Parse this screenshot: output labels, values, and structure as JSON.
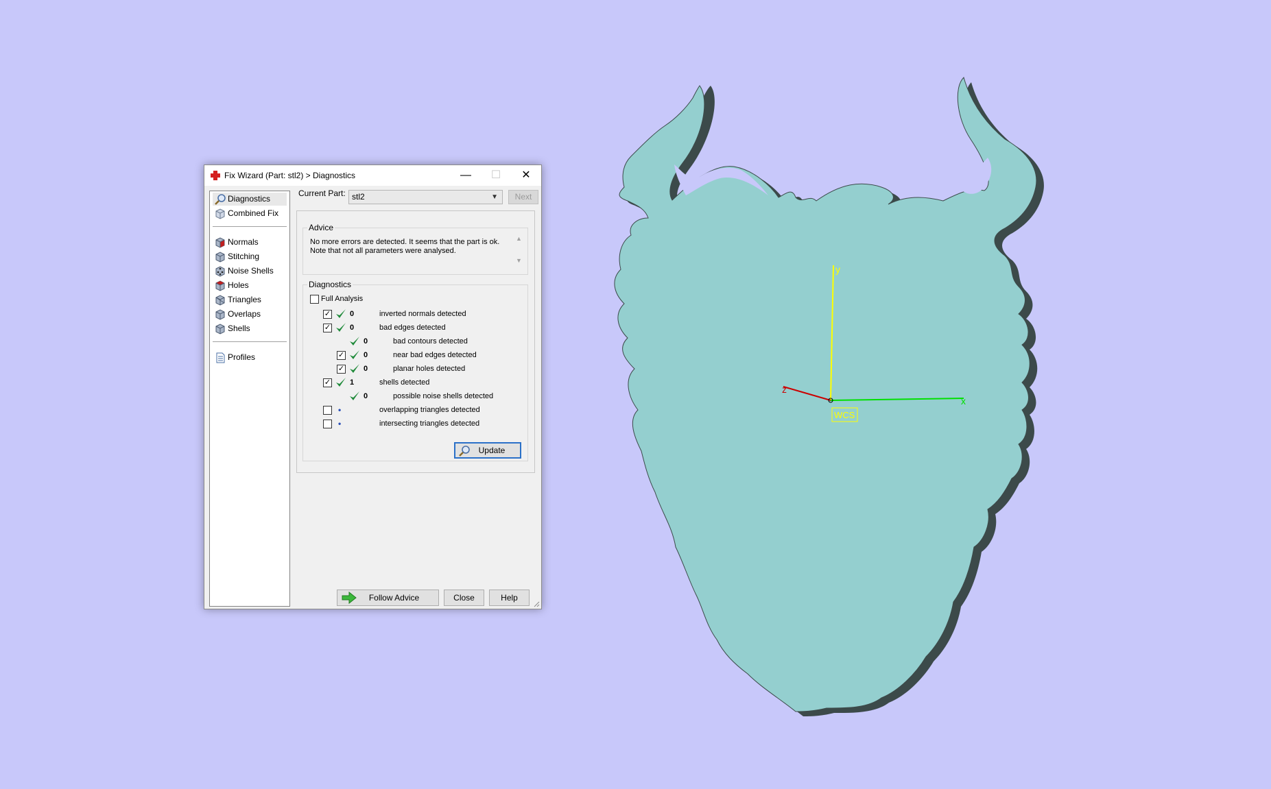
{
  "colors": {
    "viewport_background": "#c8c8fa",
    "model_fill": "#94cfcf",
    "model_edge": "#3c4a4a",
    "axis_y": "#ffff00",
    "axis_x": "#00e000",
    "axis_z": "#cc0000",
    "check_green": "#1f8a3a"
  },
  "window": {
    "title": "Fix Wizard (Part: stl2) > Diagnostics",
    "app_icon": "red-cross-icon",
    "minimize_label": "—",
    "maximize_label": "☐",
    "close_label": "✕"
  },
  "nav": {
    "items": [
      {
        "label": "Diagnostics",
        "icon": "magnifier-icon"
      },
      {
        "label": "Combined Fix",
        "icon": "cube-icon"
      },
      {
        "label": "Normals",
        "icon": "cube-red-face-icon"
      },
      {
        "label": "Stitching",
        "icon": "cube-icon"
      },
      {
        "label": "Noise Shells",
        "icon": "dice-icon"
      },
      {
        "label": "Holes",
        "icon": "cube-red-face-icon"
      },
      {
        "label": "Triangles",
        "icon": "cube-icon"
      },
      {
        "label": "Overlaps",
        "icon": "cube-icon"
      },
      {
        "label": "Shells",
        "icon": "cube-icon"
      },
      {
        "label": "Profiles",
        "icon": "document-icon"
      }
    ]
  },
  "current_part": {
    "label": "Current Part:",
    "value": "stl2",
    "next_label": "Next"
  },
  "advice": {
    "title": "Advice",
    "line1": "No more errors are detected. It seems that the part is ok.",
    "line2": "Note that not all parameters were analysed."
  },
  "diagnostics": {
    "title": "Diagnostics",
    "full_analysis_label": "Full Analysis",
    "full_analysis_checked": false,
    "rows": [
      {
        "checkbox": true,
        "status": "ok",
        "count": "0",
        "text": "inverted normals detected",
        "indent": 0
      },
      {
        "checkbox": true,
        "status": "ok",
        "count": "0",
        "text": "bad edges detected",
        "indent": 0
      },
      {
        "checkbox": null,
        "status": "ok",
        "count": "0",
        "text": "bad contours detected",
        "indent": 1
      },
      {
        "checkbox": true,
        "status": "ok",
        "count": "0",
        "text": "near bad edges detected",
        "indent": 1
      },
      {
        "checkbox": true,
        "status": "ok",
        "count": "0",
        "text": "planar holes detected",
        "indent": 1
      },
      {
        "checkbox": true,
        "status": "ok",
        "count": "1",
        "text": "shells detected",
        "indent": 0
      },
      {
        "checkbox": null,
        "status": "ok",
        "count": "0",
        "text": "possible noise shells detected",
        "indent": 1
      },
      {
        "checkbox": false,
        "status": "pending",
        "count": "•",
        "text": "overlapping triangles detected",
        "indent": 0
      },
      {
        "checkbox": false,
        "status": "pending",
        "count": "•",
        "text": "intersecting triangles detected",
        "indent": 0
      }
    ],
    "update_label": "Update"
  },
  "footer": {
    "follow_advice_label": "Follow Advice",
    "close_label": "Close",
    "help_label": "Help"
  },
  "axes": {
    "y_label": "y",
    "x_label": "x",
    "z_label": "z",
    "wcs_label": "WCS"
  }
}
